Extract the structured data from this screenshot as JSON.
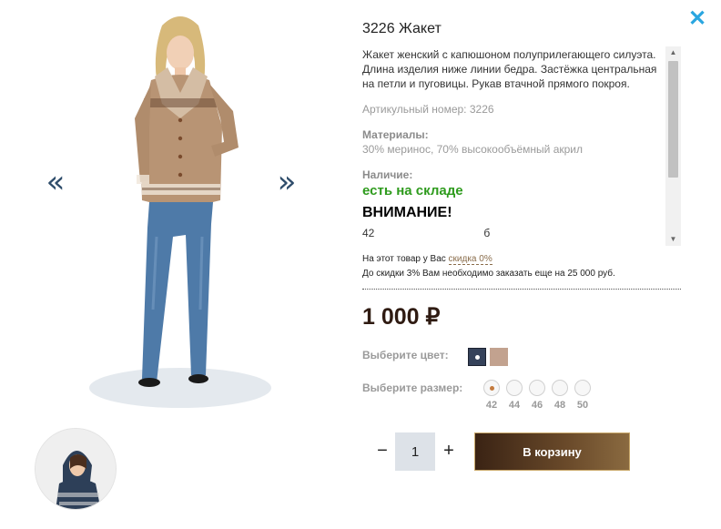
{
  "close_icon": "close-icon",
  "gallery": {
    "prev_arrow": "«",
    "next_arrow": "»",
    "main_image": "woman-in-beige-knit-cardigan-and-jeans",
    "thumbnail": "woman-in-navy-hooded-cardigan"
  },
  "product": {
    "title": "3226 Жакет",
    "description": "Жакет женский с капюшоном полуприлегающего силуэта. Длина изделия ниже линии бедра. Застёжка центральная на петли и пуговицы. Рукав втачной прямого покроя.",
    "article": "Артикульный номер: 3226",
    "materials_label": "Материалы:",
    "materials_value": "30% меринос, 70% высокообъёмный акрил",
    "availability_label": "Наличие:",
    "availability_value": "есть на складе",
    "attention": "ВНИМАНИЕ!",
    "cut_text": "42                                    б"
  },
  "discount": {
    "line1_prefix": "На этот товар у Вас ",
    "line1_link": "скидка 0%",
    "line2": "До скидки 3% Вам необходимо заказать еще на 25 000 руб."
  },
  "price": "1 000 ₽",
  "color": {
    "label": "Выберите цвет:",
    "options": [
      {
        "name": "navy",
        "hex": "#35425a",
        "selected": true
      },
      {
        "name": "beige",
        "hex": "#c2a28f",
        "selected": false
      }
    ]
  },
  "size": {
    "label": "Выберите размер:",
    "options": [
      "42",
      "44",
      "46",
      "48",
      "50"
    ],
    "selected": "42"
  },
  "quantity": {
    "minus": "−",
    "value": "1",
    "plus": "+"
  },
  "cart_button": "В корзину",
  "colors": {
    "accent": "#2aa6e0",
    "in_stock": "#2e9b1d",
    "price": "#2f1b12",
    "button_dark": "#3a2314"
  }
}
